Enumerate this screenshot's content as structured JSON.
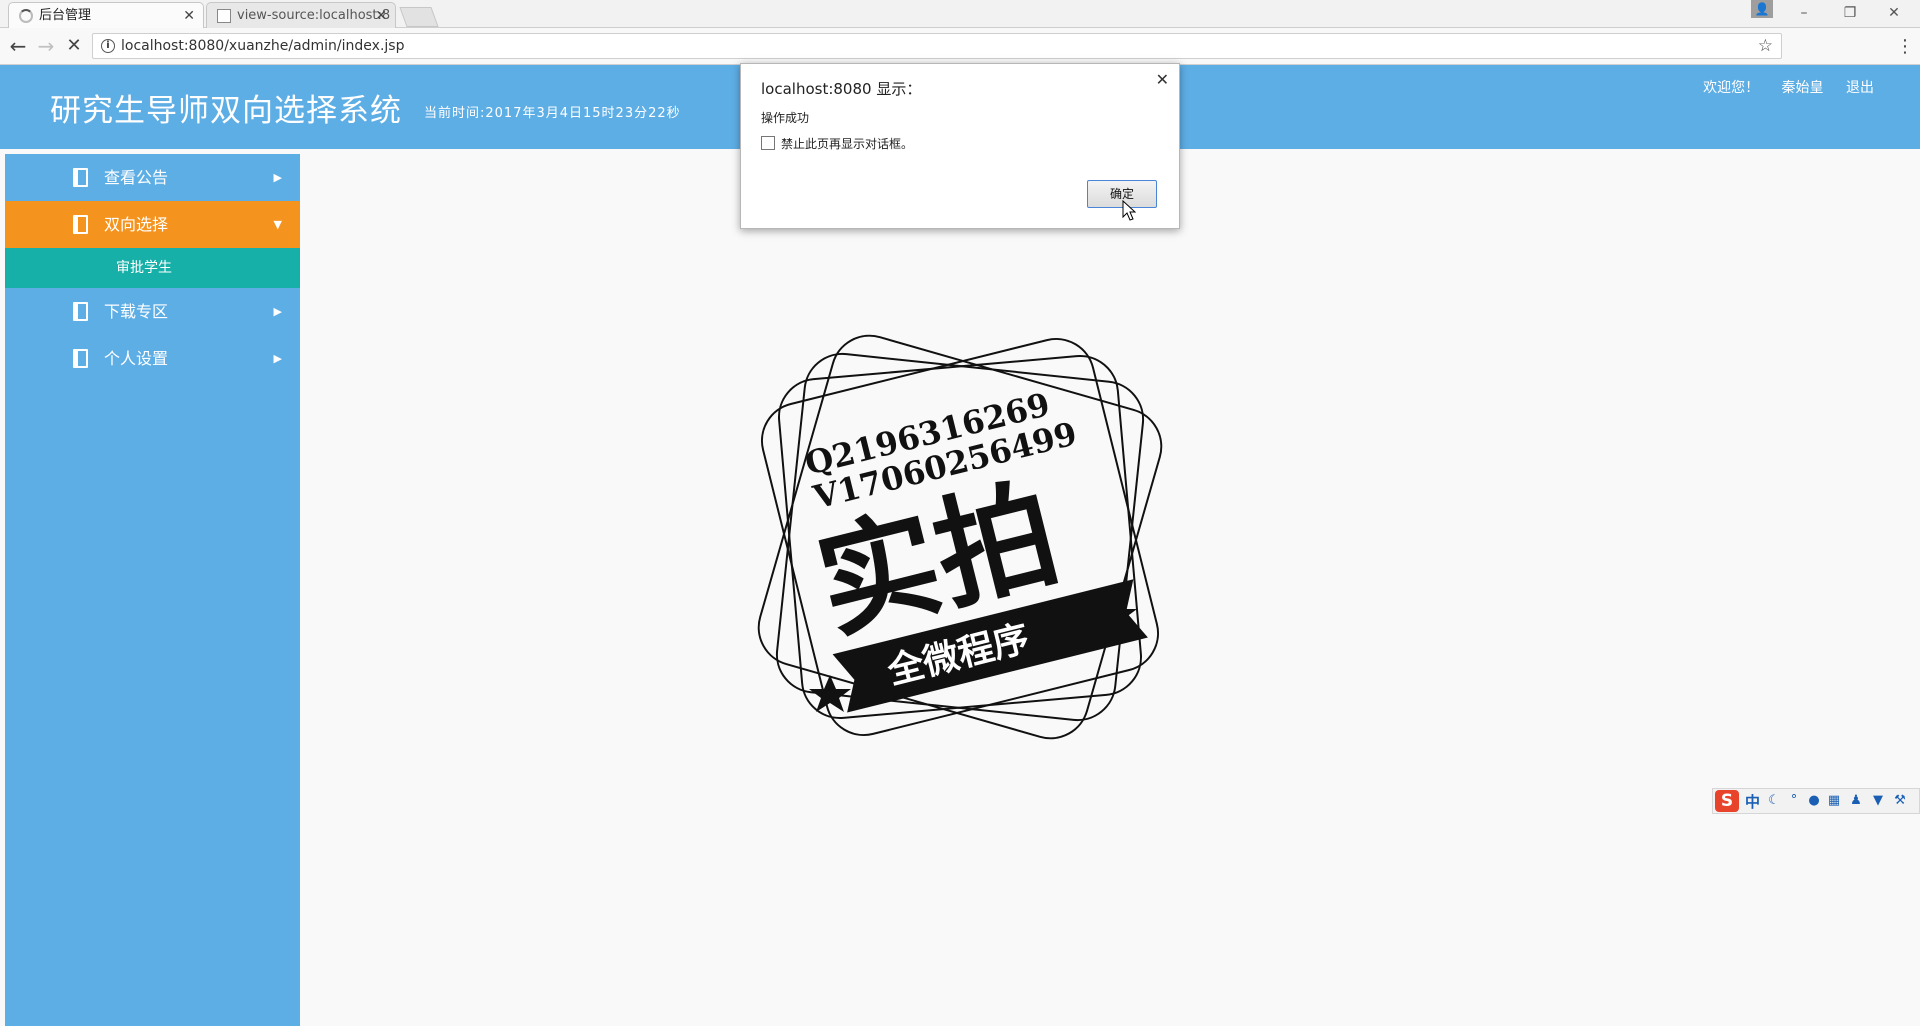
{
  "browser": {
    "tabs": [
      {
        "title": "后台管理",
        "active": true
      },
      {
        "title": "view-source:localhost:8",
        "active": false
      }
    ],
    "url": "localhost:8080/xuanzhe/admin/index.jsp"
  },
  "header": {
    "title": "研究生导师双向选择系统",
    "time": "当前时间:2017年3月4日15时23分22秒",
    "welcome": "欢迎您！",
    "username": "秦始皇",
    "logout": "退出"
  },
  "sidebar": {
    "items": [
      {
        "label": "查看公告"
      },
      {
        "label": "双向选择"
      },
      {
        "label": "下载专区"
      },
      {
        "label": "个人设置"
      }
    ],
    "submenu": {
      "label": "审批学生"
    }
  },
  "dialog": {
    "title": "localhost:8080 显示：",
    "message": "操作成功",
    "checkbox_label": "禁止此页再显示对话框。",
    "ok_label": "确定"
  },
  "ime": {
    "mode": "中"
  },
  "colors": {
    "header_bg": "#5eaee6",
    "sidebar_bg": "#5eaee6",
    "active_item": "#f5931f",
    "submenu_bg": "#17b0a8"
  }
}
